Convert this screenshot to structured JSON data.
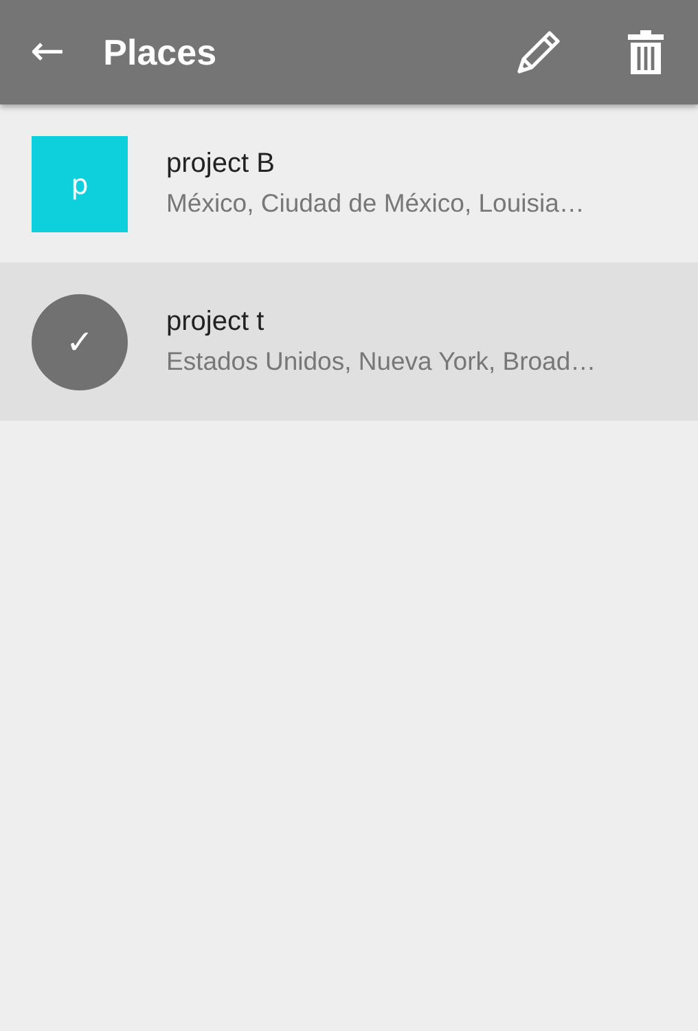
{
  "toolbar": {
    "back_icon": "←",
    "title": "Places"
  },
  "places": [
    {
      "avatar_text": "p",
      "color": "#0dd0dc",
      "title": "project B",
      "subtitle": "México, Ciudad de México, Louisia…",
      "selected": false
    },
    {
      "avatar_text": "✓",
      "color": "#717171",
      "title": "project t",
      "subtitle": "Estados Unidos, Nueva York, Broad…",
      "selected": true
    }
  ]
}
